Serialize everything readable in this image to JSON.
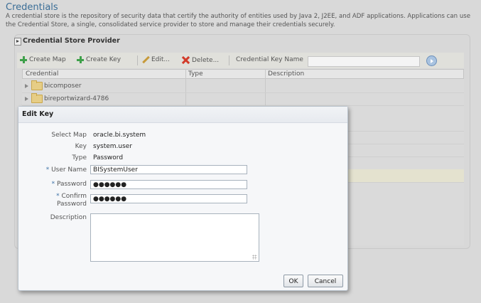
{
  "page": {
    "title": "Credentials",
    "intro": "A credential store is the repository of security data that certify the authority of entities used by Java 2, J2EE, and ADF applications. Applications can use the Credential Store, a single, consolidated service provider to store and manage their credentials securely."
  },
  "panel": {
    "title": "Credential Store Provider"
  },
  "toolbar": {
    "create_map": "Create Map",
    "create_key": "Create Key",
    "edit": "Edit...",
    "delete": "Delete...",
    "key_name_label": "Credential Key Name",
    "key_name_value": ""
  },
  "table": {
    "columns": [
      "Credential",
      "Type",
      "Description"
    ],
    "rows": [
      {
        "credential": "bicomposer",
        "type": "",
        "description": ""
      },
      {
        "credential": "bireportwizard-4786",
        "type": "",
        "description": ""
      }
    ]
  },
  "dialog": {
    "title": "Edit Key",
    "select_map_label": "Select Map",
    "select_map_value": "oracle.bi.system",
    "key_label": "Key",
    "key_value": "system.user",
    "type_label": "Type",
    "type_value": "Password",
    "user_name_label": "User Name",
    "user_name_value": "BISystemUser",
    "password_label": "Password",
    "password_value": "●●●●●●",
    "confirm_label_1": "Confirm",
    "confirm_label_2": "Password",
    "confirm_value": "●●●●●●",
    "description_label": "Description",
    "description_value": "",
    "ok": "OK",
    "cancel": "Cancel"
  },
  "colors": {
    "title": "#3b6e97",
    "required_star": "#3f73a8",
    "add_icon": "#3ea04a",
    "delete_icon": "#d23b2a"
  },
  "icons": [
    "plus-icon",
    "pencil-icon",
    "delete-x-icon",
    "go-arrow-icon",
    "folder-icon",
    "expand-triangle-icon",
    "resize-grip-icon"
  ]
}
